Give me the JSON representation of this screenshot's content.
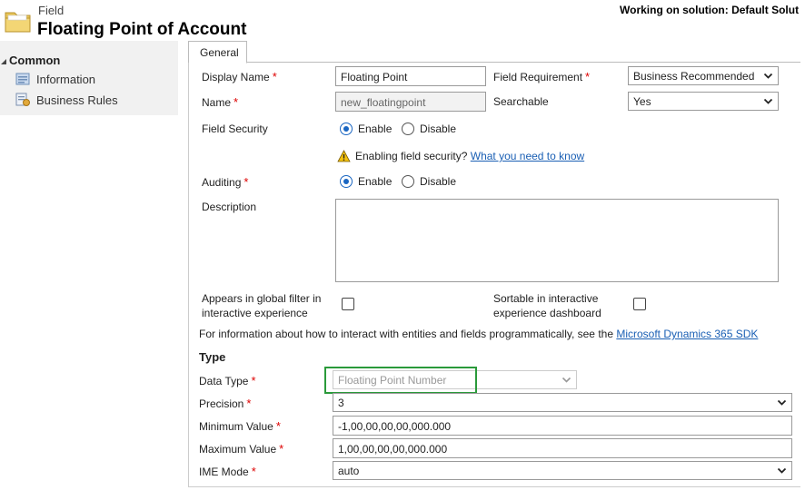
{
  "header": {
    "entity": "Field",
    "title": "Floating Point of Account",
    "solution": "Working on solution: Default Solut"
  },
  "nav": {
    "section": "Common",
    "items": [
      {
        "label": "Information",
        "icon": "information-page-icon"
      },
      {
        "label": "Business Rules",
        "icon": "business-rules-icon"
      }
    ]
  },
  "tabs": [
    {
      "label": "General"
    }
  ],
  "form": {
    "display_name": {
      "label": "Display Name",
      "value": "Floating Point"
    },
    "field_requirement": {
      "label": "Field Requirement",
      "value": "Business Recommended"
    },
    "name": {
      "label": "Name",
      "value": "new_floatingpoint"
    },
    "searchable": {
      "label": "Searchable",
      "value": "Yes"
    },
    "field_security": {
      "label": "Field Security",
      "enable": "Enable",
      "disable": "Disable",
      "selected": "Enable"
    },
    "security_note": {
      "text": "Enabling field security?",
      "link": "What you need to know"
    },
    "auditing": {
      "label": "Auditing",
      "enable": "Enable",
      "disable": "Disable",
      "selected": "Enable"
    },
    "description": {
      "label": "Description",
      "value": ""
    },
    "global_filter": {
      "label_line1": "Appears in global filter in",
      "label_line2": "interactive experience",
      "checked": false
    },
    "sortable": {
      "label_line1": "Sortable in interactive",
      "label_line2": "experience dashboard",
      "checked": false
    },
    "sdk_info": {
      "text": "For information about how to interact with entities and fields programmatically, see the",
      "link": "Microsoft Dynamics 365 SDK"
    }
  },
  "type_section": {
    "title": "Type",
    "data_type": {
      "label": "Data Type",
      "value": "Floating Point Number"
    },
    "precision": {
      "label": "Precision",
      "value": "3"
    },
    "minimum_value": {
      "label": "Minimum Value",
      "value": "-1,00,00,00,00,000.000"
    },
    "maximum_value": {
      "label": "Maximum Value",
      "value": "1,00,00,00,00,000.000"
    },
    "ime_mode": {
      "label": "IME Mode",
      "value": "auto"
    }
  },
  "colors": {
    "required": "#dd0000",
    "link": "#1a5fb4",
    "highlight": "#2a9a3a",
    "radio_selected": "#1a66c2"
  }
}
